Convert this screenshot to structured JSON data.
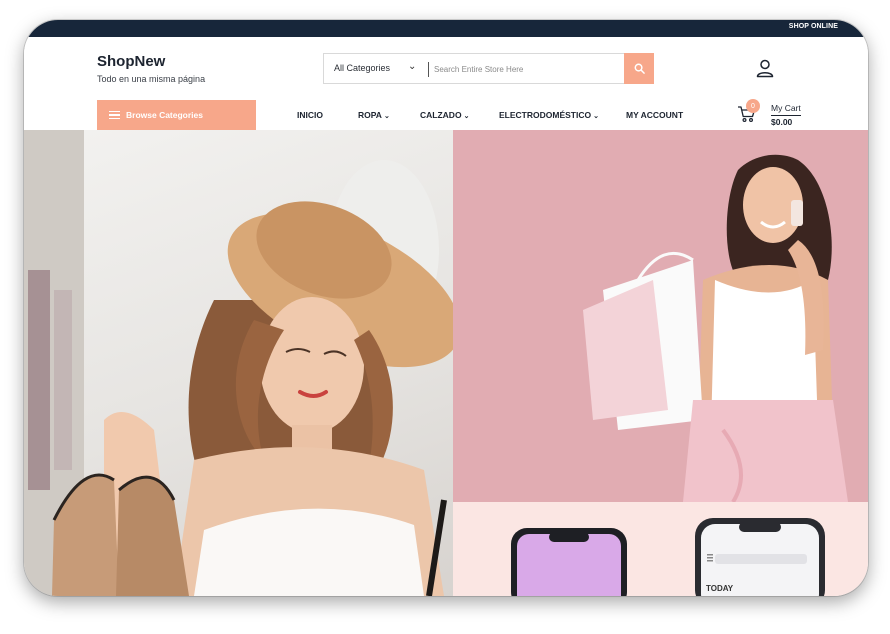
{
  "topbar": {
    "text": "SHOP ONLINE"
  },
  "brand": {
    "title": "ShopNew",
    "tagline": "Todo en una misma página"
  },
  "search": {
    "category_label": "All Categories",
    "placeholder": "Search Entire Store Here",
    "value": ""
  },
  "browse": {
    "label": "Browse Categories"
  },
  "nav": {
    "items": [
      {
        "label": "INICIO",
        "has_dropdown": false
      },
      {
        "label": "ROPA",
        "has_dropdown": true
      },
      {
        "label": "CALZADO",
        "has_dropdown": true
      },
      {
        "label": "ELECTRODOMÉSTICO",
        "has_dropdown": true
      },
      {
        "label": "MY ACCOUNT",
        "has_dropdown": false
      }
    ]
  },
  "cart": {
    "count": "0",
    "label": "My Cart",
    "total": "$0.00"
  },
  "promo": {
    "phone_label": "TODAY"
  },
  "colors": {
    "accent": "#f7a78a",
    "topbar": "#17263a",
    "hero_right_bg": "#e3aeb4",
    "promo_bg": "#fbe6e3"
  },
  "icons": [
    "user-icon",
    "search-icon",
    "cart-icon",
    "menu-icon",
    "chevron-down-icon"
  ]
}
